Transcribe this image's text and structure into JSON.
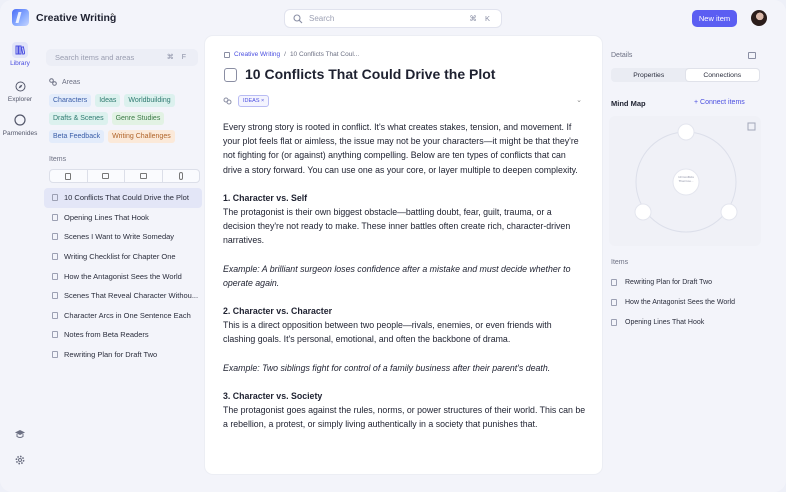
{
  "app": {
    "title": "Creative Writing"
  },
  "search": {
    "placeholder": "Search",
    "shortcut": "⌘ K"
  },
  "header": {
    "new_item": "New item"
  },
  "rail": {
    "items": [
      {
        "label": "Library"
      },
      {
        "label": "Explorer"
      },
      {
        "label": "Parmenides"
      }
    ]
  },
  "sidebar": {
    "search_placeholder": "Search items and areas",
    "search_shortcut": "⌘ F",
    "areas_heading": "Areas",
    "areas": [
      {
        "label": "Characters",
        "color": "blue"
      },
      {
        "label": "Ideas",
        "color": "teal"
      },
      {
        "label": "Worldbuilding",
        "color": "teal"
      },
      {
        "label": "Drafts & Scenes",
        "color": "teal"
      },
      {
        "label": "Genre Studies",
        "color": "green"
      },
      {
        "label": "Beta Feedback",
        "color": "blue"
      },
      {
        "label": "Writing Challenges",
        "color": "orange"
      }
    ],
    "items_heading": "Items",
    "items": [
      {
        "label": "10 Conflicts That Could Drive the Plot"
      },
      {
        "label": "Opening Lines That Hook"
      },
      {
        "label": "Scenes I Want to Write Someday"
      },
      {
        "label": "Writing Checklist for Chapter One"
      },
      {
        "label": "How the Antagonist Sees the World"
      },
      {
        "label": "Scenes That Reveal Character Withou..."
      },
      {
        "label": "Character Arcs in One Sentence Each"
      },
      {
        "label": "Notes from Beta Readers"
      },
      {
        "label": "Rewriting Plan for Draft Two"
      }
    ]
  },
  "doc": {
    "breadcrumb": {
      "root": "Creative Writing",
      "sep": "/",
      "current": "10 Conflicts That Coul..."
    },
    "title": "10 Conflicts That Could Drive the Plot",
    "tag": "IDEAS",
    "intro": "Every strong story is rooted in conflict. It's what creates stakes, tension, and movement. If your plot feels flat or aimless, the issue may not be your characters—it might be that they're not fighting for (or against) anything compelling. Below are ten types of conflicts that can drive a story forward. You can use one as your core, or layer multiple to deepen complexity.",
    "sections": [
      {
        "heading": "1. Character vs. Self",
        "text": "The protagonist is their own biggest obstacle—battling doubt, fear, guilt, trauma, or a decision they're not ready to make. These inner battles often create rich, character-driven narratives.",
        "example": "Example: A brilliant surgeon loses confidence after a mistake and must decide whether to operate again."
      },
      {
        "heading": "2. Character vs. Character",
        "text": "This is a direct opposition between two people—rivals, enemies, or even friends with clashing goals. It's personal, emotional, and often the backbone of drama.",
        "example": "Example: Two siblings fight for control of a family business after their parent's death."
      },
      {
        "heading": "3. Character vs. Society",
        "text": "The protagonist goes against the rules, norms, or power structures of their world. This can be a rebellion, a protest, or simply living authentically in a society that punishes that."
      }
    ]
  },
  "details": {
    "heading": "Details",
    "tabs": [
      "Properties",
      "Connections"
    ],
    "mindmap": {
      "heading": "Mind Map",
      "connect": "+ Connect items",
      "center": "10 Conflicts That Cou..."
    },
    "items_heading": "Items",
    "items": [
      {
        "label": "Rewriting Plan for Draft Two"
      },
      {
        "label": "How the Antagonist Sees the World"
      },
      {
        "label": "Opening Lines That Hook"
      }
    ]
  },
  "colors": {
    "accent": "#5b5ef2",
    "link": "#4a4ee0"
  }
}
